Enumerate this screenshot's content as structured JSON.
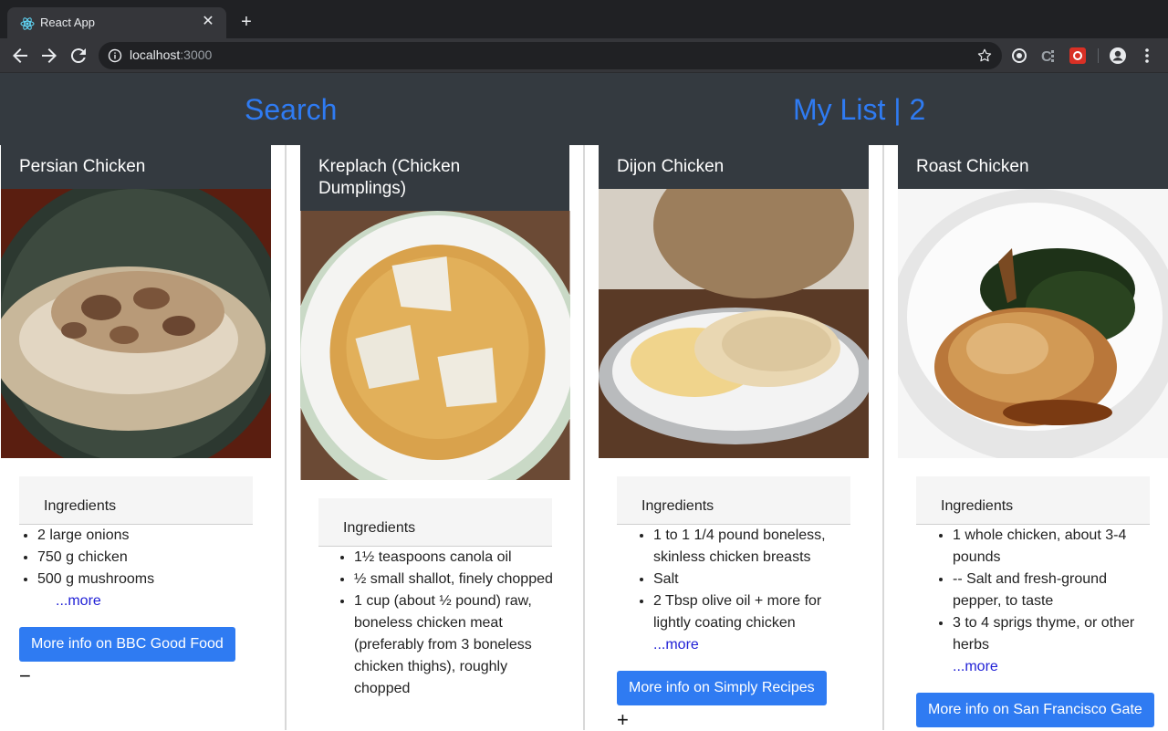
{
  "browser": {
    "tab_title": "React App",
    "url_host": "localhost",
    "url_port": ":3000"
  },
  "header": {
    "search_label": "Search",
    "mylist_label": "My List | 2"
  },
  "recipes": [
    {
      "title": "Persian Chicken",
      "ingredients_title": "Ingredients",
      "ingredients": [
        "2 large onions",
        "750 g chicken",
        "500 g mushrooms"
      ],
      "more": "...more",
      "button": "More info on BBC Good Food",
      "toggle": "−"
    },
    {
      "title": "Kreplach (Chicken Dumplings)",
      "ingredients_title": "Ingredients",
      "ingredients": [
        "1½ teaspoons canola oil",
        "½ small shallot, finely chopped",
        "1 cup (about ½ pound) raw, boneless chicken meat (preferably from 3 boneless chicken thighs), roughly chopped"
      ],
      "more": "",
      "button": "",
      "toggle": ""
    },
    {
      "title": "Dijon Chicken",
      "ingredients_title": "Ingredients",
      "ingredients": [
        "1 to 1 1/4 pound boneless, skinless chicken breasts",
        "Salt",
        "2 Tbsp olive oil + more for lightly coating chicken"
      ],
      "more": "...more",
      "button": "More info on Simply Recipes",
      "toggle": "+"
    },
    {
      "title": "Roast Chicken",
      "ingredients_title": "Ingredients",
      "ingredients": [
        "1 whole chicken, about 3-4 pounds",
        "-- Salt and fresh-ground pepper, to taste",
        "3 to 4 sprigs thyme, or other herbs"
      ],
      "more": "...more",
      "button": "More info on San Francisco Gate",
      "toggle": ""
    }
  ],
  "colors": {
    "link_blue": "#2f7bf2",
    "header_bg": "#343a40",
    "more_link": "#1f1fd6"
  }
}
